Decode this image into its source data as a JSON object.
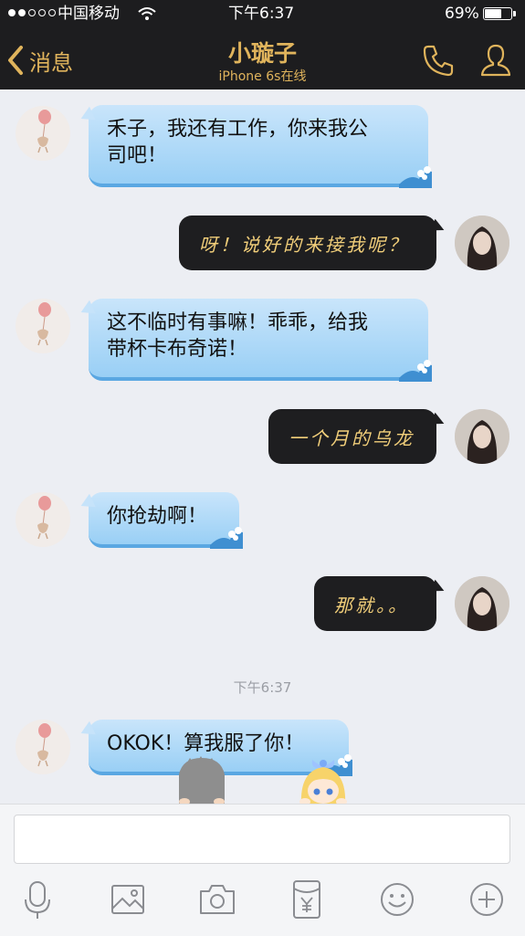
{
  "status_bar": {
    "carrier": "中国移动",
    "time": "下午6:37",
    "battery_percent": "69%",
    "battery_level": 0.69,
    "signal_bars": 2
  },
  "header": {
    "back_label": "消息",
    "contact_name": "小璇子",
    "contact_status": "iPhone 6s在线"
  },
  "messages": [
    {
      "side": "incoming",
      "text_lines": [
        "禾子，我还有工作，你来我公",
        "司吧！"
      ]
    },
    {
      "side": "outgoing",
      "text": "呀！说好的来接我呢？"
    },
    {
      "side": "incoming",
      "text_lines": [
        "这不临时有事嘛！乖乖，给我",
        "带杯卡布奇诺！"
      ]
    },
    {
      "side": "outgoing",
      "text": "一个月的乌龙"
    },
    {
      "side": "incoming",
      "text_lines": [
        "你抢劫啊！"
      ]
    },
    {
      "side": "outgoing",
      "text": "那就。。"
    },
    {
      "timestamp": "下午6:37"
    },
    {
      "side": "incoming",
      "text_lines": [
        "OKOK！算我服了你！"
      ]
    }
  ],
  "input": {
    "placeholder": "",
    "value": ""
  },
  "toolbar": [
    "microphone-icon",
    "image-icon",
    "camera-icon",
    "red-packet-icon",
    "emoji-icon",
    "plus-icon"
  ],
  "colors": {
    "header_bg": "#1d1d1f",
    "accent_gold": "#e0b45c",
    "incoming_bubble": "#a9d8f7",
    "outgoing_bubble": "#1e1e20",
    "outgoing_text": "#f2cf7a",
    "chat_bg": "#eceef3"
  }
}
